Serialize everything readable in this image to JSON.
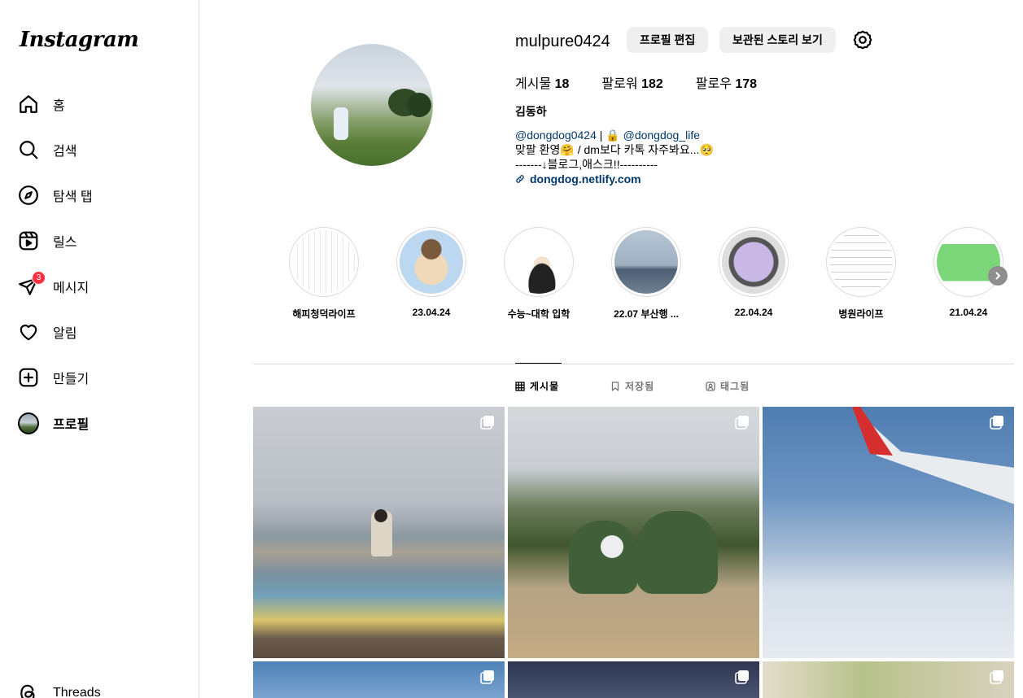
{
  "sidebar": {
    "logo": "Instagram",
    "items": [
      {
        "label": "홈",
        "icon": "home-icon"
      },
      {
        "label": "검색",
        "icon": "search-icon"
      },
      {
        "label": "탐색 탭",
        "icon": "compass-icon"
      },
      {
        "label": "릴스",
        "icon": "reels-icon"
      },
      {
        "label": "메시지",
        "icon": "messenger-icon",
        "badge": "3"
      },
      {
        "label": "알림",
        "icon": "heart-icon"
      },
      {
        "label": "만들기",
        "icon": "plus-square-icon"
      },
      {
        "label": "프로필",
        "icon": "avatar"
      }
    ],
    "threads": "Threads"
  },
  "profile": {
    "username": "mulpure0424",
    "edit_button": "프로필 편집",
    "archive_button": "보관된 스토리 보기",
    "stats": {
      "posts_label": "게시물",
      "posts": "18",
      "followers_label": "팔로워",
      "followers": "182",
      "following_label": "팔로우",
      "following": "178"
    },
    "full_name": "김동하",
    "bio": {
      "line1_tag1": "@dongdog0424",
      "line1_sep": " | 🔒 ",
      "line1_tag2": "@dongdog_life",
      "line2": "맞팔 환영🤗 / dm보다 카톡 자주봐요...🥺",
      "line3": "-------↓블로그,애스크!!----------",
      "link": "dongdog.netlify.com"
    }
  },
  "highlights": [
    {
      "label": "해피청덕라이프"
    },
    {
      "label": "23.04.24"
    },
    {
      "label": "수능~대학 입학"
    },
    {
      "label": "22.07 부산행 ..."
    },
    {
      "label": "22.04.24"
    },
    {
      "label": "병원라이프"
    },
    {
      "label": "21.04.24"
    }
  ],
  "tabs": [
    {
      "label": "게시물",
      "icon": "grid-icon",
      "active": true
    },
    {
      "label": "저장됨",
      "icon": "bookmark-icon",
      "active": false
    },
    {
      "label": "태그됨",
      "icon": "tagged-icon",
      "active": false
    }
  ],
  "colors": {
    "badge": "#ff3040",
    "link": "#00376b",
    "button_bg": "#efefef",
    "border": "#dbdbdb"
  }
}
